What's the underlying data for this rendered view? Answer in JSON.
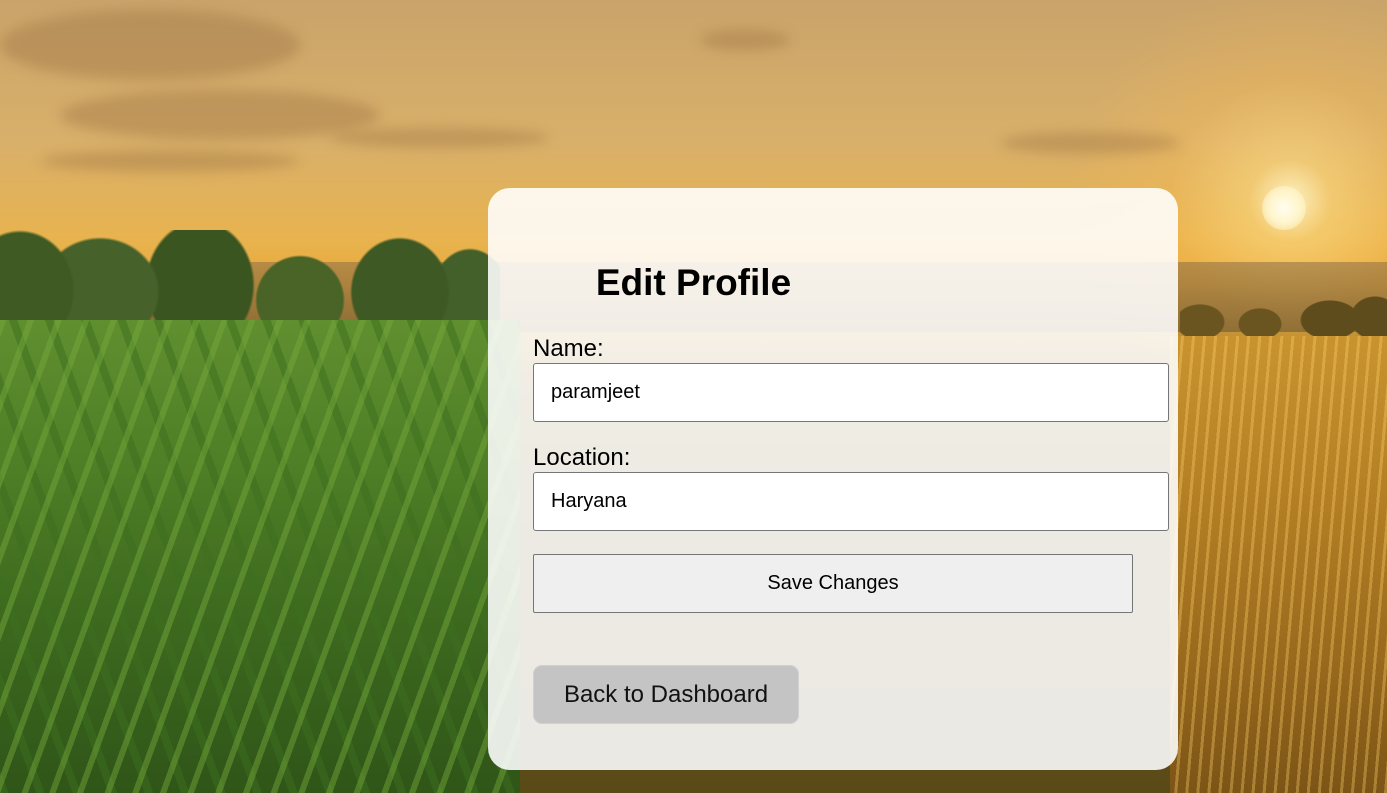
{
  "page": {
    "title": "Edit Profile"
  },
  "form": {
    "name_label": "Name:",
    "name_value": "paramjeet",
    "location_label": "Location:",
    "location_value": "Haryana",
    "save_label": "Save Changes"
  },
  "navigation": {
    "back_label": "Back to Dashboard"
  },
  "colors": {
    "card_background": "#ffffff",
    "save_button": "#efefef",
    "back_button": "#c4c4c4",
    "text": "#000000"
  }
}
